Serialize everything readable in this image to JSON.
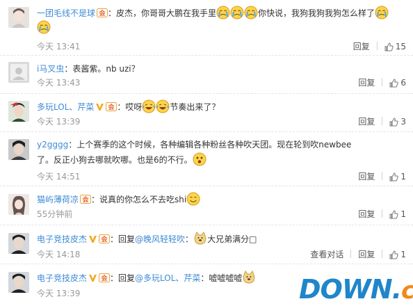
{
  "comments": [
    {
      "username": "一团毛线不是球",
      "parts": [
        "：皮杰，你哥哥大鹏在我手里",
        "你快说，我狗我狗我狗怎么样了"
      ],
      "time": "今天 13:41",
      "reply_label": "回复",
      "likes": "15"
    },
    {
      "username": "i马叉虫",
      "parts": [
        "：表酱紫。nb uzi？"
      ],
      "time": "今天 13:43",
      "reply_label": "回复",
      "likes": "6"
    },
    {
      "username": "多玩LOL、芹菜",
      "parts": [
        "：哎呀",
        "节奏出来了？"
      ],
      "time": "今天 13:39",
      "reply_label": "回复",
      "likes": "3"
    },
    {
      "username": "y2gggg",
      "parts": [
        "：上个赛季的这个时候，各种编辑各种粉丝各种吹天团。现在轮到吹newbee了。反正小狗去哪就吹哪。也是6的不行。"
      ],
      "time": "今天 14:51",
      "reply_label": "回复",
      "likes": "1"
    },
    {
      "username": "猫屿薄荷凉",
      "parts": [
        "：说真的你怎么不去吃shi"
      ],
      "time": "55分钟前",
      "reply_label": "回复",
      "likes": "1"
    },
    {
      "username": "电子竞技皮杰",
      "parts": [
        "：回复",
        "@晚风轻轻吹",
        "：",
        "大兄弟满分□"
      ],
      "time": "今天 14:18",
      "view_conversation": "查看对话",
      "reply_label": "回复",
      "likes": "1"
    },
    {
      "username": "电子竞技皮杰",
      "parts": [
        "：回复",
        "@多玩LOL、芹菜",
        "：嘘嘘嘘嘘"
      ],
      "time": "今天 13:39",
      "reply_label": "回复",
      "likes": "1"
    }
  ],
  "watermark": {
    "main": "DOWN",
    "dot": ".",
    "tld": "cc"
  },
  "colors": {
    "username": "#3d8bd6",
    "time": "#999999",
    "watermark_blue": "#1f86c9",
    "watermark_orange": "#f08a1a"
  }
}
